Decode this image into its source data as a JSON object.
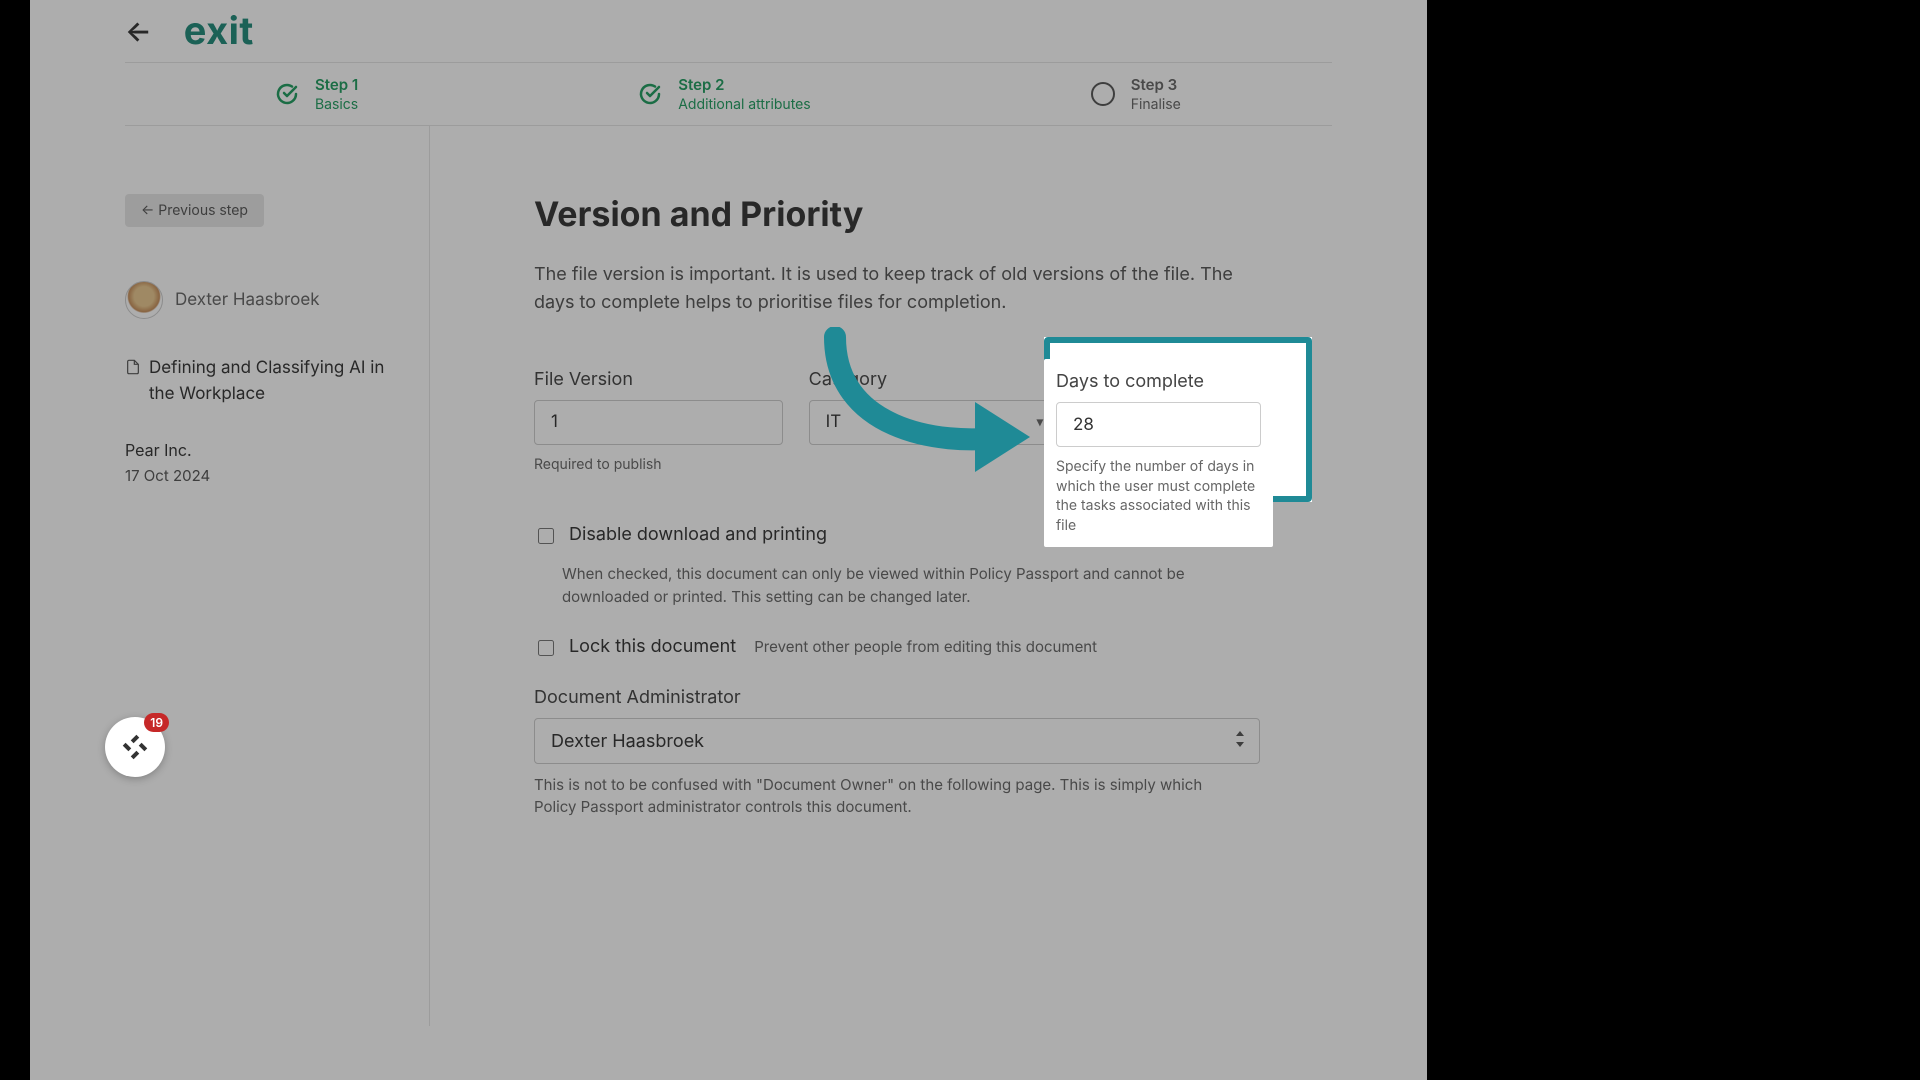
{
  "brand": "exit",
  "steps": [
    {
      "title": "Step 1",
      "sub": "Basics",
      "state": "done"
    },
    {
      "title": "Step 2",
      "sub": "Additional attributes",
      "state": "done"
    },
    {
      "title": "Step 3",
      "sub": "Finalise",
      "state": "todo"
    }
  ],
  "sidebar": {
    "previous_label": "←  Previous step",
    "user_name": "Dexter Haasbroek",
    "document_title": "Defining and Classifying AI in the Workplace",
    "org": "Pear Inc.",
    "date": "17 Oct 2024"
  },
  "main": {
    "section_title": "Version and Priority",
    "section_desc": "The file version is important. It is used to keep track of old versions of the file. The days to complete helps to prioritise files for completion.",
    "file_version": {
      "label": "File Version",
      "value": "1",
      "help": "Required to publish"
    },
    "category": {
      "label": "Category",
      "value": "IT"
    },
    "days": {
      "label": "Days to complete",
      "value": "28",
      "help": "Specify the number of days in which the user must complete the tasks associated with this file"
    },
    "disable_downloads": {
      "label": "Disable download and printing",
      "help": "When checked, this document can only be viewed within Policy Passport and cannot be downloaded or printed. This setting can be changed later."
    },
    "lock_document": {
      "label": "Lock this document",
      "help": "Prevent other people from editing this document"
    },
    "admin": {
      "label": "Document Administrator",
      "value": "Dexter Haasbroek",
      "help": "This is not to be confused with \"Document Owner\" on the following page. This is simply which Policy Passport administrator controls this document."
    }
  },
  "badge": {
    "count": "19"
  }
}
